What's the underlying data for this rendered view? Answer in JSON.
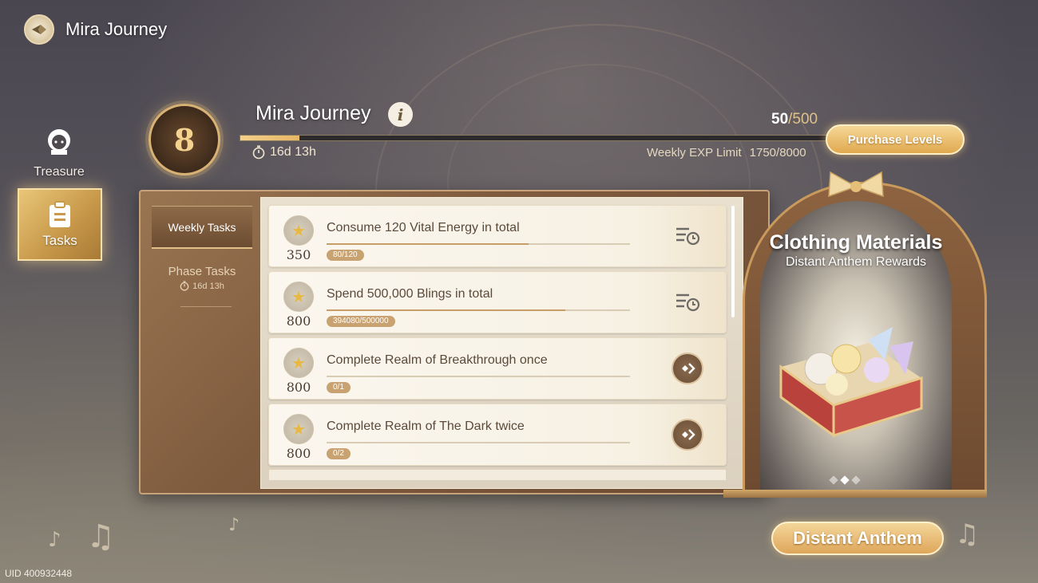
{
  "header": {
    "title": "Mira Journey"
  },
  "nav": {
    "treasure_label": "Treasure",
    "tasks_label": "Tasks"
  },
  "journey": {
    "level": "8",
    "title": "Mira Journey",
    "info_glyph": "i",
    "timer": "16d 13h",
    "exp_current": "50",
    "exp_max": "/500",
    "exp_progress_fraction": 0.1,
    "weekly_limit_label": "Weekly EXP Limit",
    "weekly_limit_value": "1750/8000",
    "purchase_label": "Purchase Levels"
  },
  "tabs": {
    "weekly_label": "Weekly Tasks",
    "phase_label": "Phase Tasks",
    "phase_timer": "16d 13h"
  },
  "tasks": [
    {
      "reward": "350",
      "title": "Consume 120 Vital Energy in total",
      "progress": "80/120",
      "fraction": 0.667,
      "action": "in-progress-icon"
    },
    {
      "reward": "800",
      "title": "Spend 500,000 Blings in total",
      "progress": "394080/500000",
      "fraction": 0.788,
      "action": "in-progress-icon"
    },
    {
      "reward": "800",
      "title": "Complete Realm of Breakthrough once",
      "progress": "0/1",
      "fraction": 0,
      "action": "go-arrow-icon"
    },
    {
      "reward": "800",
      "title": "Complete Realm of The Dark twice",
      "progress": "0/2",
      "fraction": 0,
      "action": "go-arrow-icon"
    }
  ],
  "reward_panel": {
    "title": "Clothing Materials",
    "subtitle": "Distant Anthem Rewards",
    "page_count": 3,
    "active_page": 2
  },
  "anthem_label": "Distant Anthem",
  "uid": "UID 400932448",
  "colors": {
    "accent_gold": "#e0a94e",
    "panel_brown": "#7f5b3e",
    "card_bg": "#fbf7ef"
  }
}
